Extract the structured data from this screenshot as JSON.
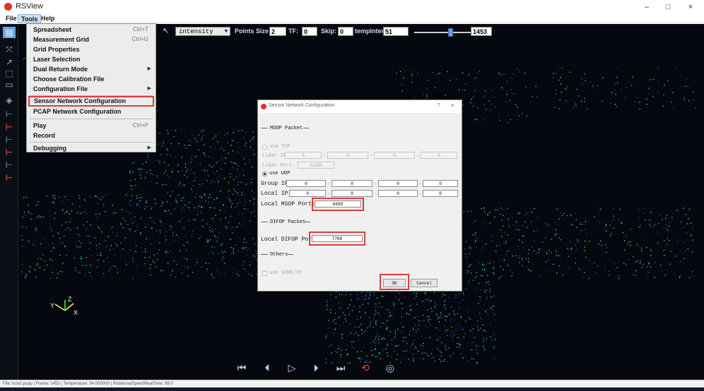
{
  "window": {
    "title": "RSView",
    "minimize": "–",
    "maximize": "□",
    "close": "×"
  },
  "menubar": {
    "file": "File",
    "tools": "Tools",
    "help": "Help"
  },
  "toolbar": {
    "dropdown_value": "intensity",
    "points_size_label": "Points Size:",
    "points_size_value": "2",
    "tf_label": "TF:",
    "tf_value": "0",
    "skip_label": "Skip:",
    "skip_value": "0",
    "tempinten_label": "tempInten:",
    "tempinten_value": "51",
    "frame_value": "1453"
  },
  "tools_menu": {
    "items": [
      {
        "label": "Spreadsheet",
        "shortcut": "Ctrl+T"
      },
      {
        "label": "Measurement Grid",
        "shortcut": "Ctrl+G"
      },
      {
        "label": "Grid Properties",
        "shortcut": ""
      },
      {
        "label": "Laser Selection",
        "shortcut": ""
      },
      {
        "label": "Dual Return Mode",
        "shortcut": ""
      },
      {
        "label": "Choose Calibration File",
        "shortcut": ""
      },
      {
        "label": "Configuration File",
        "shortcut": ""
      },
      {
        "label": "Sensor Network Configuration",
        "shortcut": ""
      },
      {
        "label": "PCAP Network Configuration",
        "shortcut": ""
      },
      {
        "label": "Play",
        "shortcut": "Ctrl+P"
      },
      {
        "label": "Record",
        "shortcut": ""
      },
      {
        "label": "Debugging",
        "shortcut": ""
      }
    ]
  },
  "dialog": {
    "title": "Sensor Network Configuration",
    "help": "?",
    "close": "×",
    "msop_section": "MSOP Packet",
    "use_tcp": "use TCP",
    "lidar_ip_label": "Lidar IP:",
    "lidar_ip": [
      "0",
      "0",
      "0",
      "0"
    ],
    "lidar_port_label": "Lidar Port:",
    "lidar_port": "51180",
    "use_udp": "use UDP",
    "group_ip_label": "Group IP:",
    "group_ip": [
      "0",
      "0",
      "0",
      "0"
    ],
    "local_ip_label": "Local  IP:",
    "local_ip": [
      "0",
      "0",
      "0",
      "0"
    ],
    "msop_port_label": "Local MSOP  Port:",
    "msop_port": "6699",
    "difop_section": "DIFOP Packet",
    "difop_port_label": "Local DIFOP Port:",
    "difop_port": "7788",
    "others_section": "Others",
    "use_someip": "use SOME/IP",
    "ok": "OK",
    "cancel": "Cancel"
  },
  "statusbar": {
    "file": "File: lcce2.pcap",
    "frame": "Frame: 1453",
    "temperature": "Temperature: 54.000000",
    "speed": "RotationalSpeedRealTime: 99.0"
  },
  "colors": {
    "highlight": "#e03a3a",
    "background": "#05090f",
    "accent": "#6b9cd6"
  }
}
